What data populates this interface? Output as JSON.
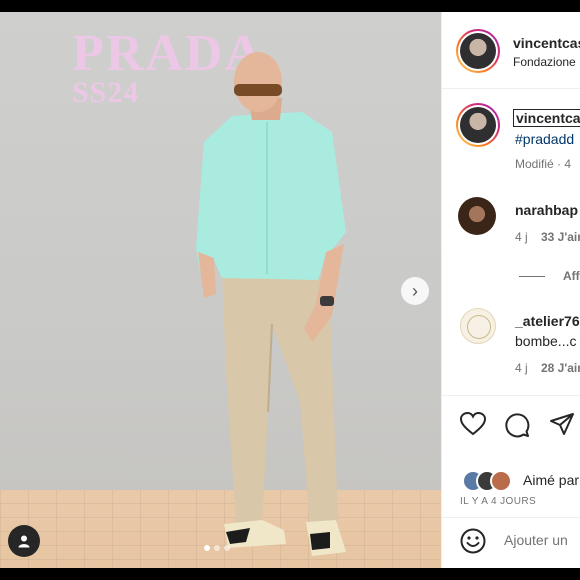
{
  "photo": {
    "brand_line1": "PRADA",
    "brand_line2": "SS24",
    "carousel_dots": 3,
    "active_dot": 0
  },
  "header": {
    "username": "vincentcas",
    "location": "Fondazione"
  },
  "caption": {
    "username": "vincentca",
    "hashtag": "#pradadd",
    "meta": "Modifié · 4"
  },
  "comments": [
    {
      "username": "narahbap",
      "meta_time": "4 j",
      "meta_likes": "33 J'aim"
    },
    {
      "username": "_atelier76",
      "text": "bombe...c",
      "meta_time": "4 j",
      "meta_likes": "28 J'aim"
    }
  ],
  "view_replies": "Aff",
  "actions": {
    "liked_by": "Aimé par",
    "timestamp": "IL Y A 4 JOURS"
  },
  "comment_box": {
    "placeholder": "Ajouter un"
  },
  "colors": {
    "brand_pink": "#ecc7e6",
    "link_blue": "#00376b"
  },
  "icons": [
    "chevron-right-icon",
    "user-tag-icon",
    "heart-icon",
    "comment-icon",
    "share-icon",
    "emoji-icon"
  ]
}
